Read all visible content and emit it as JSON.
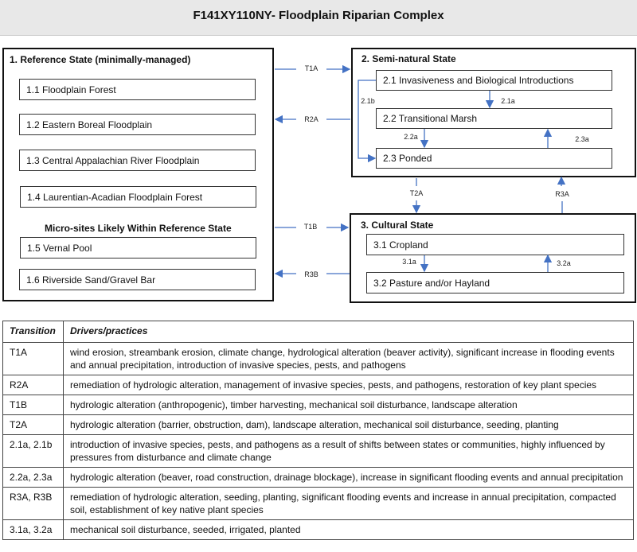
{
  "title": "F141XY110NY- Floodplain Riparian Complex",
  "accent_color": "#4472c4",
  "states": {
    "s1": {
      "heading": "1.  Reference State (minimally-managed)",
      "communities": [
        "1.1 Floodplain Forest",
        "1.2 Eastern Boreal Floodplain",
        "1.3 Central Appalachian River Floodplain",
        "1.4 Laurentian-Acadian Floodplain Forest"
      ],
      "microsites_heading": "Micro-sites Likely Within Reference State",
      "microsites": [
        "1.5 Vernal Pool",
        "1.6 Riverside Sand/Gravel Bar"
      ]
    },
    "s2": {
      "heading": "2.  Semi-natural State",
      "communities": [
        "2.1 Invasiveness and Biological Introductions",
        "2.2 Transitional Marsh",
        "2.3 Ponded"
      ]
    },
    "s3": {
      "heading": "3.  Cultural State",
      "communities": [
        "3.1 Cropland",
        "3.2 Pasture and/or Hayland"
      ]
    }
  },
  "transitions": {
    "T1A": "T1A",
    "R2A": "R2A",
    "T1B": "T1B",
    "R3B": "R3B",
    "T2A": "T2A",
    "R3A": "R3A",
    "p21a": "2.1a",
    "p21b": "2.1b",
    "p22a": "2.2a",
    "p23a": "2.3a",
    "p31a": "3.1a",
    "p32a": "3.2a"
  },
  "table": {
    "headers": [
      "Transition",
      "Drivers/practices"
    ],
    "rows": [
      {
        "t": "T1A",
        "d": "wind erosion, streambank erosion, climate change, hydrological alteration (beaver activity), significant increase in flooding events and annual precipitation, introduction of invasive species, pests, and pathogens"
      },
      {
        "t": "R2A",
        "d": "remediation of hydrologic alteration, management of invasive species, pests, and pathogens, restoration of key plant species"
      },
      {
        "t": "T1B",
        "d": "hydrologic alteration (anthropogenic), timber harvesting, mechanical soil disturbance, landscape alteration"
      },
      {
        "t": "T2A",
        "d": "hydrologic alteration (barrier, obstruction, dam), landscape alteration, mechanical soil disturbance, seeding, planting"
      },
      {
        "t": "2.1a, 2.1b",
        "d": "introduction of invasive species, pests, and pathogens as a result of shifts between states or communities, highly influenced by pressures from disturbance and climate change"
      },
      {
        "t": "2.2a, 2.3a",
        "d": "hydrologic alteration (beaver, road construction, drainage blockage), increase in significant flooding events and annual precipitation"
      },
      {
        "t": "R3A, R3B",
        "d": "remediation of hydrologic alteration, seeding, planting, significant flooding events and increase in annual precipitation, compacted soil, establishment of key native plant species"
      },
      {
        "t": "3.1a, 3.2a",
        "d": "mechanical soil disturbance, seeded, irrigated, planted"
      }
    ]
  }
}
